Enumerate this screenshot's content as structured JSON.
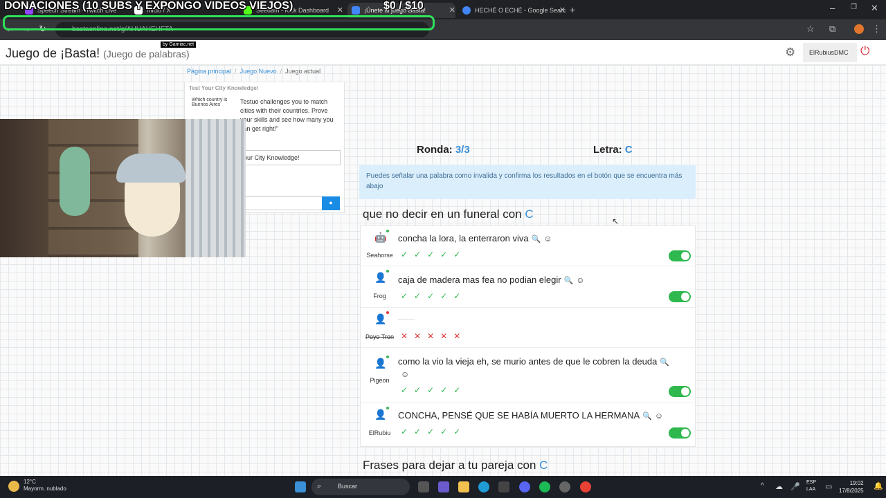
{
  "browser": {
    "overlay_title": "DONACIONES (10 SUBS Y EXPONGO VIDEOS VIEJOS)",
    "overlay_money": "$0 / $10",
    "tabs": [
      {
        "label": "Speech Stream - Twitch Live",
        "fav_color": "#9146ff"
      },
      {
        "label": "Inicio / X",
        "fav_color": "#ffffff"
      },
      {
        "label": "Seedam - Kick Dashboard",
        "fav_color": "#53fc18"
      },
      {
        "label": "¡Únete al juego Basta!",
        "fav_color": "#4285f4"
      },
      {
        "label": "HECHÉ O ECHÉ - Google Search",
        "fav_color": "#4285f4"
      }
    ],
    "url": "bastaonline.net/g/AHUAHEHFTA"
  },
  "site": {
    "brand": "Juego de ¡Basta!",
    "brand_sub": "(Juego de palabras)",
    "gamiac": "by Gamiac.net",
    "username": "ElRubiusDMC"
  },
  "breadcrumb": {
    "home": "Página principal",
    "new_game": "Juego Nuevo",
    "current": "Juego actual"
  },
  "ad": {
    "title": "Test Your City Knowledge!",
    "question": "Which country is Buenos Aires",
    "body": "Testuo challenges you to match cities with their countries. Prove your skills and see how many you can get right!\"",
    "cta": "our City Knowledge!"
  },
  "game": {
    "round_label": "Ronda:",
    "round_value": "3/3",
    "letter_label": "Letra:",
    "letter_value": "C",
    "info": "Puedes señalar una palabra como invalida y confirma los resultados en el botón que se encuentra más abajo",
    "category1_prefix": "que no decir en un funeral con",
    "category1_letter": "C",
    "category2_prefix": "Frases para dejar a tu pareja con",
    "category2_letter": "C",
    "answers": [
      {
        "player": "Seahorse",
        "text": "concha la lora, la enterraron viva",
        "votes": "✓✓✓✓✓",
        "valid": true
      },
      {
        "player": "Frog",
        "text": "caja de madera mas fea no podian elegir",
        "votes": "✓✓✓✓✓",
        "valid": true
      },
      {
        "player": "Poyo Tron",
        "text": "",
        "votes": "✕✕✕✕✕",
        "valid": false
      },
      {
        "player": "Pigeon",
        "text": "como la vio la vieja eh, se murio antes de que le cobren la deuda",
        "votes": "✓✓✓✓✓",
        "valid": true
      },
      {
        "player": "ElRubiu",
        "text": "CONCHA, PENSÉ QUE SE HABÍA MUERTO LA HERMANA",
        "votes": "✓✓✓✓✓",
        "valid": true
      }
    ]
  },
  "taskbar": {
    "temp": "12°C",
    "weather": "Mayorm. nublado",
    "search": "Buscar",
    "lang1": "ESP",
    "lang2": "LAA",
    "time": "19:02",
    "date": "17/8/2025"
  }
}
